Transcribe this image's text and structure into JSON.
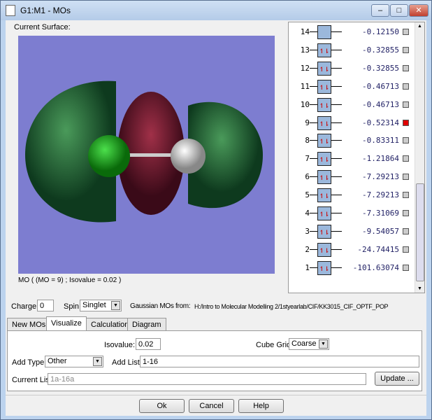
{
  "window": {
    "title": "G1:M1 - MOs"
  },
  "viewer": {
    "label": "Current Surface:",
    "status": "MO ( (MO = 9) ; Isovalue = 0.02 )"
  },
  "orbitals": [
    {
      "n": "14",
      "energy": "-0.12150",
      "occupied": false,
      "selected": false
    },
    {
      "n": "13",
      "energy": "-0.32855",
      "occupied": true,
      "selected": false
    },
    {
      "n": "12",
      "energy": "-0.32855",
      "occupied": true,
      "selected": false
    },
    {
      "n": "11",
      "energy": "-0.46713",
      "occupied": true,
      "selected": false
    },
    {
      "n": "10",
      "energy": "-0.46713",
      "occupied": true,
      "selected": false
    },
    {
      "n": "9",
      "energy": "-0.52314",
      "occupied": true,
      "selected": true
    },
    {
      "n": "8",
      "energy": "-0.83311",
      "occupied": true,
      "selected": false
    },
    {
      "n": "7",
      "energy": "-1.21864",
      "occupied": true,
      "selected": false
    },
    {
      "n": "6",
      "energy": "-7.29213",
      "occupied": true,
      "selected": false
    },
    {
      "n": "5",
      "energy": "-7.29213",
      "occupied": true,
      "selected": false
    },
    {
      "n": "4",
      "energy": "-7.31069",
      "occupied": true,
      "selected": false
    },
    {
      "n": "3",
      "energy": "-9.54057",
      "occupied": true,
      "selected": false
    },
    {
      "n": "2",
      "energy": "-24.74415",
      "occupied": true,
      "selected": false
    },
    {
      "n": "1",
      "energy": "-101.63074",
      "occupied": true,
      "selected": false
    }
  ],
  "params": {
    "charge_label": "Charge:",
    "charge": "0",
    "spin_label": "Spin:",
    "spin": "Singlet",
    "source_label": "Gaussian MOs from:",
    "source": "H:/Intro to Molecular Modelling 2/1styearlab/CIF/KK3015_CIF_OPTF_POP"
  },
  "tabs": [
    "New MOs",
    "Visualize",
    "Calculation",
    "Diagram"
  ],
  "visualize": {
    "isovalue_label": "Isovalue:",
    "isovalue": "0.02",
    "cube_grid_label": "Cube Grid:",
    "cube_grid": "Coarse",
    "add_type_label": "Add Type:",
    "add_type": "Other",
    "add_list_label": "Add List:",
    "add_list": "1-16",
    "current_list_label": "Current List:",
    "current_list": "1a-16a",
    "update": "Update ..."
  },
  "buttons": {
    "ok": "Ok",
    "cancel": "Cancel",
    "help": "Help"
  },
  "colors": {
    "selected": "#e00000",
    "viewport": "#7d7dd0"
  }
}
